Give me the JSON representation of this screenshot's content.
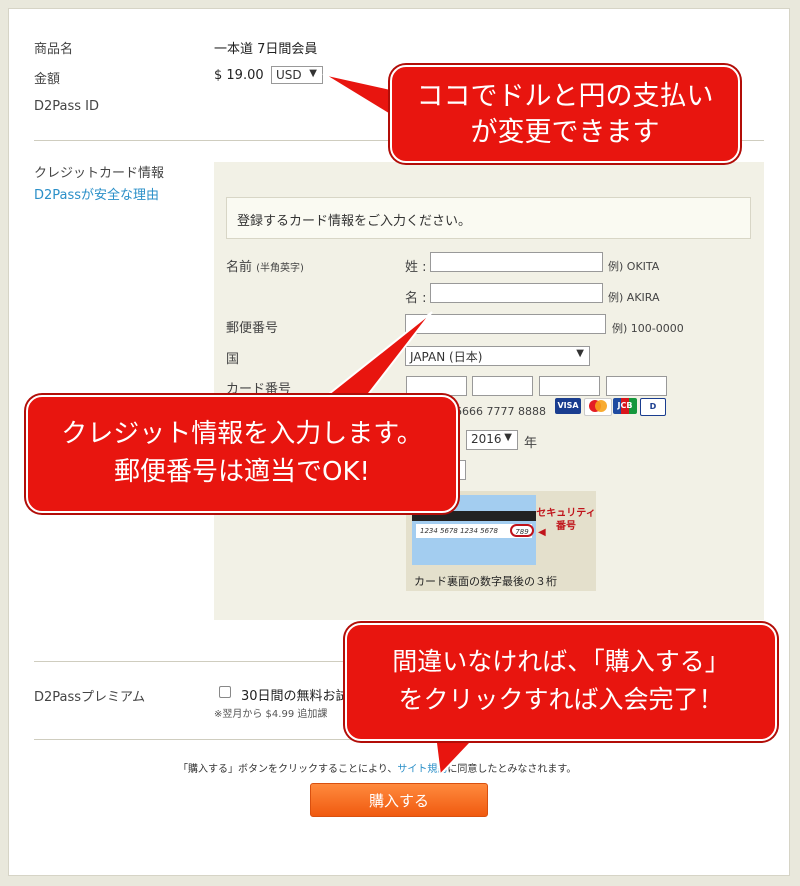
{
  "product": {
    "label": "商品名",
    "value": "一本道 7日間会員"
  },
  "price": {
    "label": "金額",
    "amount": "$ 19.00",
    "currency": "USD"
  },
  "d2pass_id": {
    "label": "D2Pass ID"
  },
  "card_section": {
    "label": "クレジットカード情報",
    "safety_link": "D2Passが安全な理由",
    "notice": "登録するカード情報をご入力ください。",
    "name_label": "名前",
    "name_sub": "(半角英字)",
    "last_label": "姓 :",
    "last_hint": "例) OKITA",
    "first_label": "名 :",
    "first_hint": "例) AKIRA",
    "zip_label": "郵便番号",
    "zip_hint": "例) 100-0000",
    "country_label": "国",
    "country_value": "JAPAN (日本)",
    "cardno_label": "カード番号",
    "cardno_example": "6666 7777 8888",
    "year_value": "2016",
    "year_unit": "年",
    "cvv_caption": "カード裏面の数字最後の３桁",
    "cvv_card_number": "1234 5678 1234 5678",
    "cvv_code": "789",
    "cvv_note_1": "セキュリティ",
    "cvv_note_2": "番号",
    "brands": [
      "VISA",
      "MC",
      "JCB",
      "D"
    ]
  },
  "premium": {
    "label": "D2Passプレミアム",
    "checkbox_label": "30日間の無料お試",
    "note": "※翌月から $4.99 追加課"
  },
  "terms": {
    "before": "「購入する」ボタンをクリックすることにより、",
    "link": "サイト規約",
    "after": "に同意したとみなされます。"
  },
  "submit": {
    "label": "購入する"
  },
  "callouts": {
    "currency_1": "ココでドルと円の支払い",
    "currency_2": "が変更できます",
    "credit_1": "クレジット情報を入力します。",
    "credit_2": "郵便番号は適当でOK!",
    "purchase_1": "間違いなければ、「購入する」",
    "purchase_2": "をクリックすれば入会完了！"
  }
}
